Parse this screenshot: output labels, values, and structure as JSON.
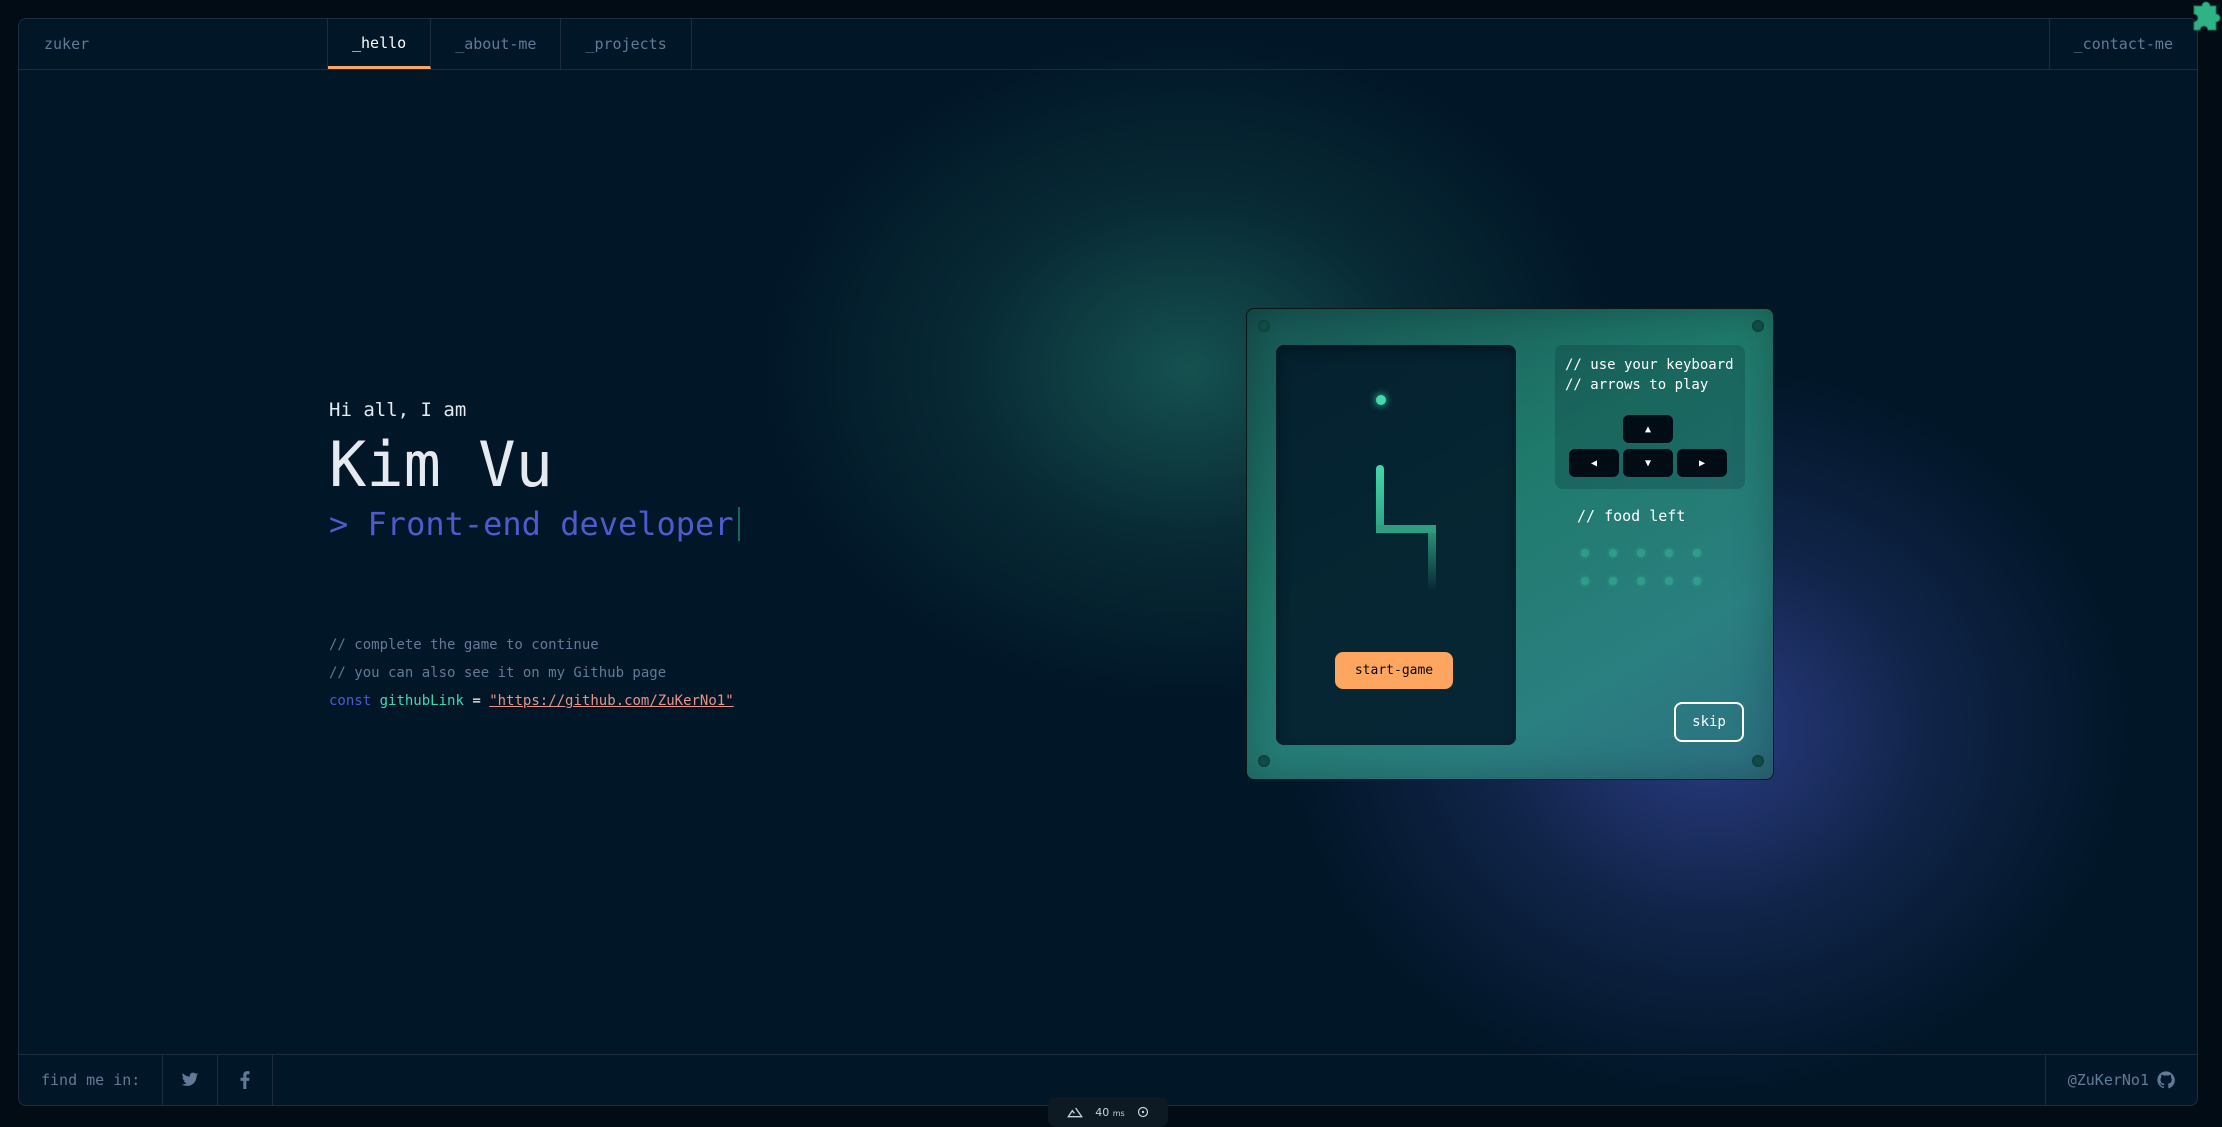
{
  "header": {
    "brand": "zuker",
    "tabs": [
      {
        "label": "_hello",
        "active": true
      },
      {
        "label": "_about-me",
        "active": false
      },
      {
        "label": "_projects",
        "active": false
      }
    ],
    "contact": "_contact-me"
  },
  "hero": {
    "greeting": "Hi all, I am",
    "name": "Kim Vu",
    "role": "> Front-end developer"
  },
  "comments": {
    "line1": "// complete the game to continue",
    "line2": "// you can also see it on my Github page",
    "code_keyword": "const",
    "code_var": "githubLink",
    "code_eq": "=",
    "code_value": "\"https://github.com/ZuKerNo1\""
  },
  "game": {
    "instructions": "// use your keyboard\n// arrows to play",
    "keys": {
      "up": "▲",
      "left": "◀",
      "down": "▼",
      "right": "▶"
    },
    "food_title": "// food left",
    "food_count": 10,
    "start_label": "start-game",
    "skip_label": "skip"
  },
  "footer": {
    "find_label": "find me in:",
    "handle": "@ZuKerNo1",
    "icons": [
      "twitter-icon",
      "facebook-icon",
      "github-icon"
    ]
  },
  "dev_badge": {
    "value": "40",
    "unit": "ms"
  },
  "colors": {
    "background": "#011627",
    "accent_orange": "#fea55f",
    "accent_green": "#43d9ad",
    "accent_purple": "#4d5bce",
    "string_red": "#e99287",
    "muted": "#607b96"
  }
}
